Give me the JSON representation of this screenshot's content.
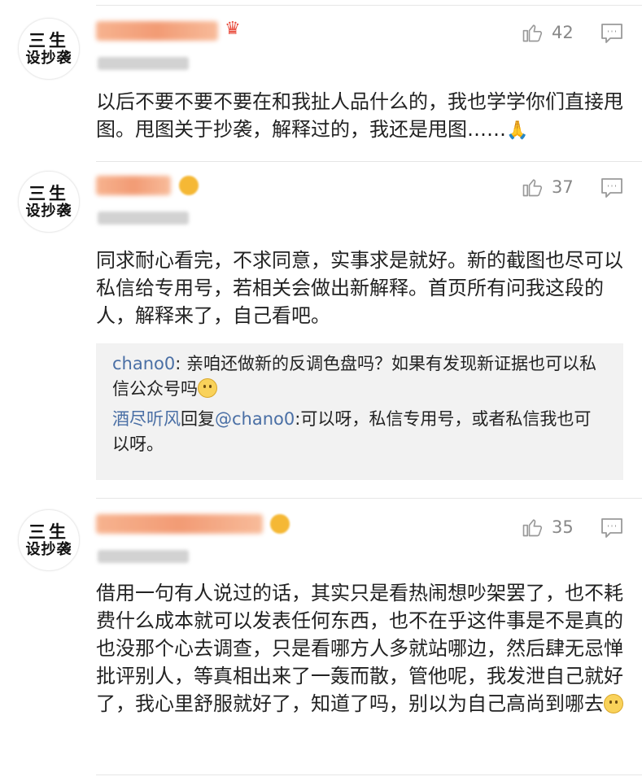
{
  "avatar": {
    "line1": "三生",
    "line2": "设抄袭"
  },
  "comments": [
    {
      "likes": "42",
      "text": "以后不要不要不要在和我扯人品什么的，我也学学你们直接甩图。甩图关于抄袭，解释过的，我还是甩图……",
      "emoji": "praying-hands"
    },
    {
      "likes": "37",
      "text": "同求耐心看完，不求同意，实事求是就好。新的截图也尽可以私信给专用号，若相关会做出新解释。首页所有问我这段的人，解释来了，自己看吧。",
      "replies": [
        {
          "name": "chano0",
          "text": ": 亲咱还做新的反调色盘吗？如果有发现新证据也可以私信公众号吗"
        },
        {
          "name": "酒尽听风",
          "reply_word": "回复",
          "mention": "@chano0",
          "text": ":可以呀，私信专用号，或者私信我也可以呀。"
        }
      ]
    },
    {
      "likes": "35",
      "text": "借用一句有人说过的话，其实只是看热闹想吵架罢了，也不耗费什么成本就可以发表任何东西，也不在乎这件事是不是真的也没那个心去调查，只是看哪方人多就站哪边，然后肆无忌惮批评别人，等真相出来了一轰而散，管他呢，我发泄自己就好了，我心里舒服就好了，知道了吗，别以为自己高尚到哪去"
    }
  ],
  "colors": {
    "name_link": "#4a6fa5",
    "reply_bg": "#f2f2f2",
    "like_text": "#888888"
  },
  "icons": {
    "like": "thumbs-up-icon",
    "reply": "comment-icon"
  }
}
